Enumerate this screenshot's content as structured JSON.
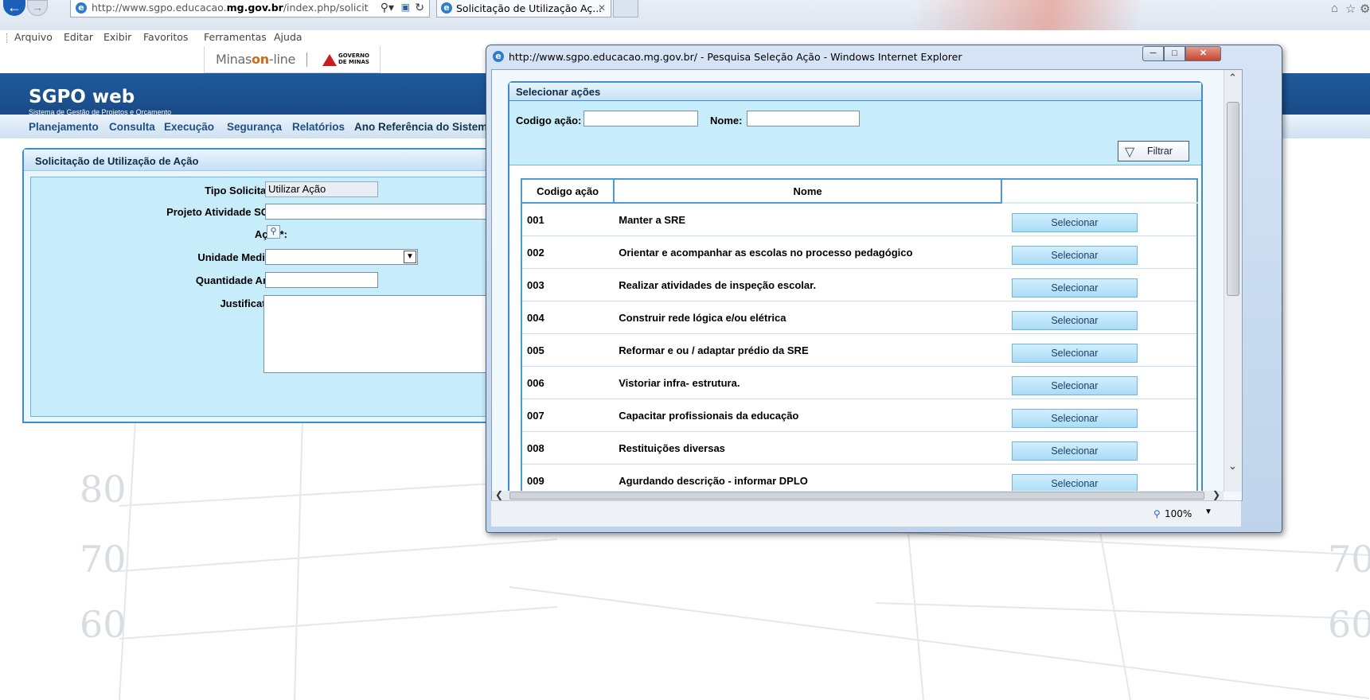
{
  "browser": {
    "url_prefix": "http://www.sgpo.educacao.",
    "url_bold": "mg.gov.br",
    "url_suffix": "/index.php/solicit",
    "tab_title": "Solicitação de Utilização Aç...",
    "menu": [
      "Arquivo",
      "Editar",
      "Exibir",
      "Favoritos",
      "Ferramentas",
      "Ajuda"
    ]
  },
  "site": {
    "minas_logo_prefix": "Minas",
    "minas_logo_on": "on",
    "minas_logo_suffix": "-line",
    "gov_logo_line1": "GOVERNO",
    "gov_logo_line2": "DE MINAS",
    "app_name": "SGPO web",
    "app_subtitle": "Sistema de Gestão de Projetos e Orçamento",
    "top_menu": [
      "Planejamento",
      "Consulta",
      "Execução",
      "Segurança",
      "Relatórios",
      "Ano Referência do Sistema"
    ]
  },
  "form": {
    "title": "Solicitação de Utilização de Ação",
    "tipo_label": "Tipo Solicitação:",
    "tipo_value": "Utilizar Ação",
    "projeto_label": "Projeto Atividade SGPO:",
    "projeto_value": "",
    "acao_label": "Ação*:",
    "unidade_label": "Unidade Medida *:",
    "unidade_value": "",
    "quantidade_label": "Quantidade Anual:",
    "quantidade_value": "",
    "justificativa_label": "Justificativa*:",
    "justificativa_value": ""
  },
  "background": {
    "numbers": [
      "80",
      "70",
      "60",
      "70",
      "60"
    ]
  },
  "popup": {
    "window_title": "http://www.sgpo.educacao.mg.gov.br/ - Pesquisa Seleção Ação - Windows Internet Explorer",
    "panel_title": "Selecionar ações",
    "codigo_label": "Codigo ação:",
    "codigo_value": "",
    "nome_label": "Nome:",
    "nome_value": "",
    "filtrar_label": "Filtrar",
    "columns": [
      "Codigo ação",
      "Nome"
    ],
    "select_label": "Selecionar",
    "rows": [
      {
        "code": "001",
        "name": "Manter a SRE"
      },
      {
        "code": "002",
        "name": "Orientar e acompanhar as escolas no processo pedagógico"
      },
      {
        "code": "003",
        "name": "Realizar atividades de inspeção escolar."
      },
      {
        "code": "004",
        "name": "Construir rede lógica e/ou elétrica"
      },
      {
        "code": "005",
        "name": "Reformar e ou / adaptar prédio da SRE"
      },
      {
        "code": "006",
        "name": "Vistoriar infra- estrutura."
      },
      {
        "code": "007",
        "name": "Capacitar profissionais da educação"
      },
      {
        "code": "008",
        "name": "Restituições diversas"
      },
      {
        "code": "009",
        "name": "Agurdando descrição - informar DPLO"
      }
    ],
    "zoom": "100%"
  },
  "icons": {
    "back": "back-arrow-icon",
    "forward": "forward-arrow-icon",
    "filter": "funnel-icon",
    "lookup": "magnifier-icon",
    "zoom": "zoom-icon"
  },
  "colors": {
    "header_blue": "#1f5a9b",
    "panel_border": "#3b8fd0",
    "panel_fill": "#c8edfa",
    "button_fill": "#a9dcf6"
  }
}
